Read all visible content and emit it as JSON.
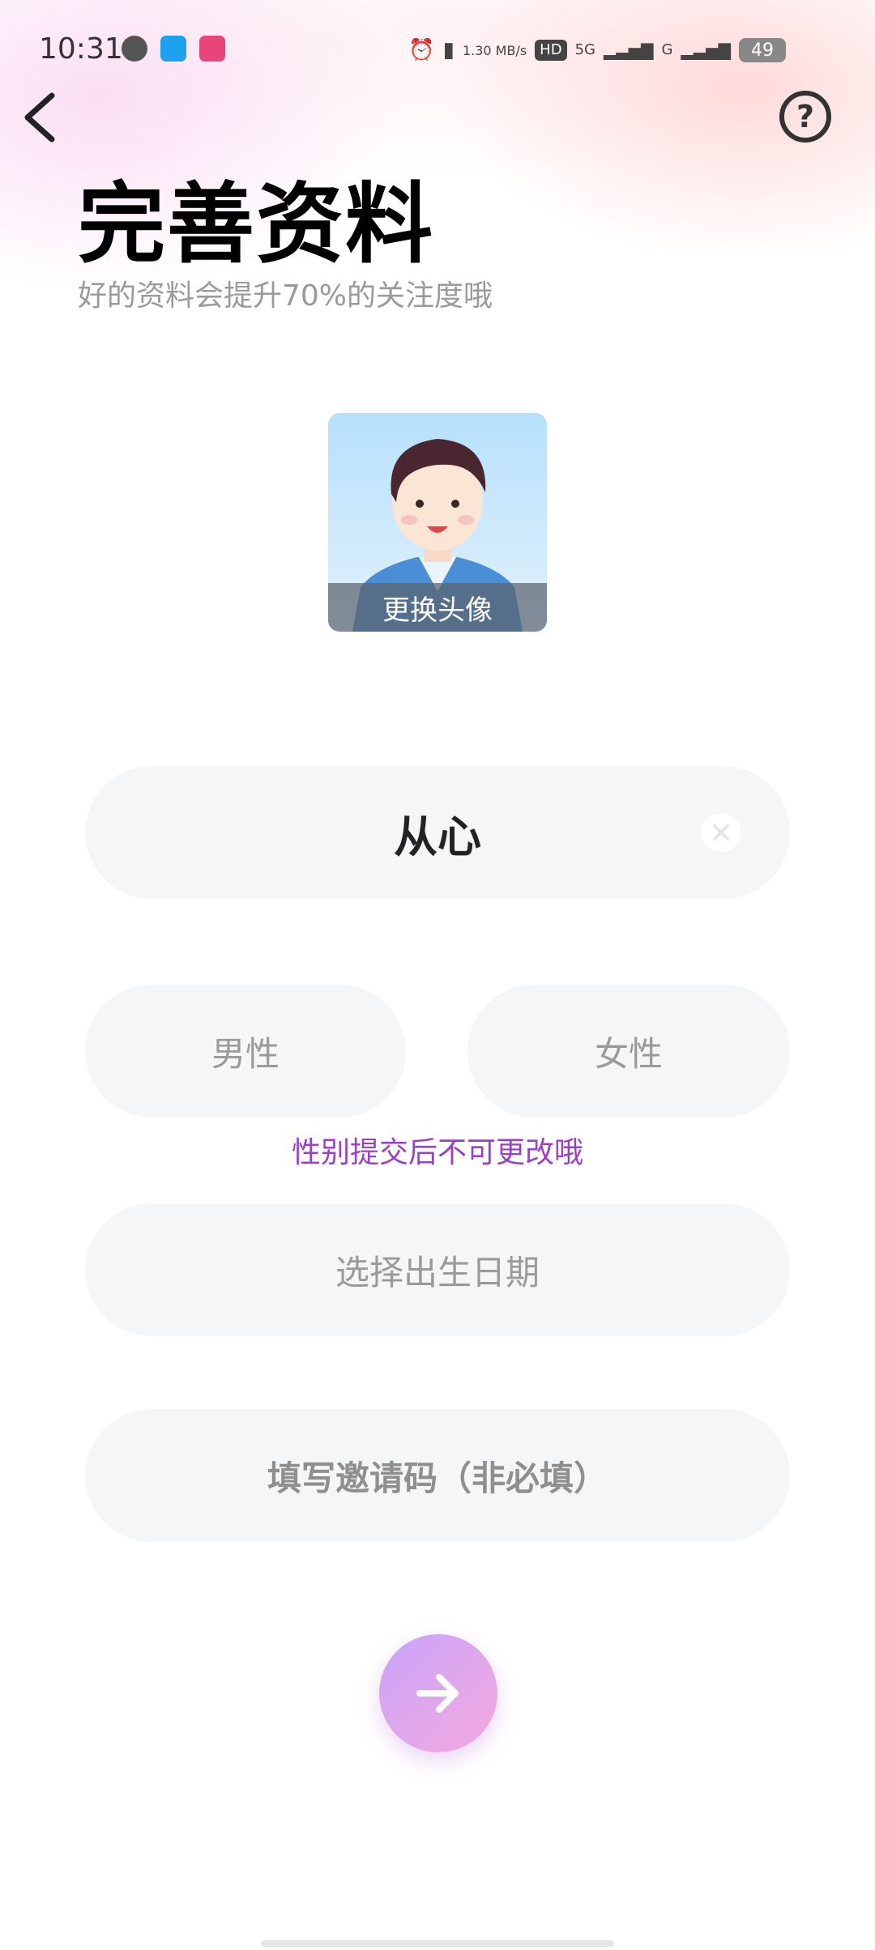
{
  "status_bar": {
    "time": "10:31",
    "network_speed": "1.30 MB/s",
    "hd_label": "HD",
    "signal_5g": "5G",
    "signal_g": "G",
    "battery": "49"
  },
  "header": {
    "title": "完善资料",
    "subtitle": "好的资料会提升70%的关注度哦",
    "help_glyph": "?"
  },
  "avatar": {
    "caption": "更换头像"
  },
  "form": {
    "nickname": "从心",
    "male_label": "男性",
    "female_label": "女性",
    "gender_tip": "性别提交后不可更改哦",
    "birth_placeholder": "选择出生日期",
    "invite_placeholder": "填写邀请码（非必填）"
  },
  "colors": {
    "tip": "#9b3fc9",
    "pill_bg": "#f5f6f8",
    "next_gradient_start": "#c9a4fb",
    "next_gradient_end": "#f4a9dc"
  },
  "icons": {
    "back": "chevron-left-icon",
    "help": "question-circle-icon",
    "clear": "clear-circle-icon",
    "next": "arrow-right-icon"
  }
}
